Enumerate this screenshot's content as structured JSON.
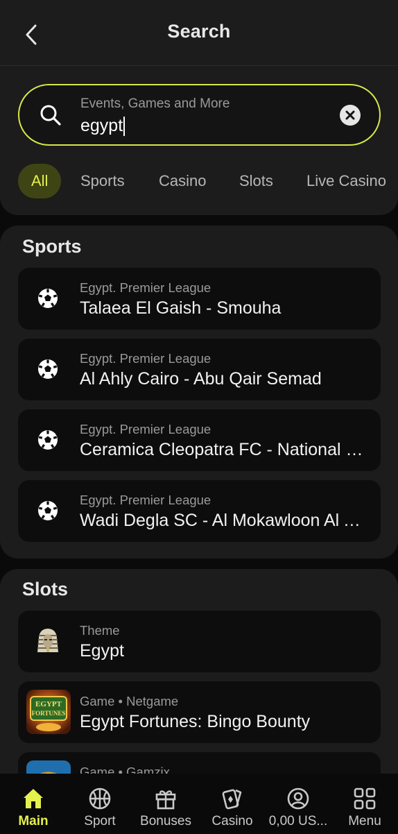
{
  "header": {
    "title": "Search"
  },
  "search": {
    "placeholder": "Events, Games and More",
    "value": "egypt"
  },
  "tabs": [
    {
      "label": "All",
      "active": true
    },
    {
      "label": "Sports"
    },
    {
      "label": "Casino"
    },
    {
      "label": "Slots"
    },
    {
      "label": "Live Casino"
    }
  ],
  "sports": {
    "title": "Sports",
    "items": [
      {
        "league": "Egypt. Premier League",
        "match": "Talaea El Gaish   - Smouha",
        "icon": "soccer-ball-icon"
      },
      {
        "league": "Egypt. Premier League",
        "match": "Al Ahly Cairo - Abu Qair Semad",
        "icon": "soccer-ball-icon"
      },
      {
        "league": "Egypt. Premier League",
        "match": "Ceramica Cleopatra FC - National Bank of Egypt",
        "icon": "soccer-ball-icon"
      },
      {
        "league": "Egypt. Premier League",
        "match": "Wadi Degla SC - Al Mokawloon Al Arab",
        "icon": "soccer-ball-icon"
      }
    ]
  },
  "slots": {
    "title": "Slots",
    "items": [
      {
        "subtitle": "Theme",
        "name": "Egypt",
        "icon": "pharaoh-icon"
      },
      {
        "subtitle": "Game • Netgame",
        "name": "Egypt Fortunes: Bingo Bounty",
        "icon": "egypt-fortunes-thumbnail",
        "thumb_text": [
          "EGYPT",
          "FORTUNES"
        ]
      },
      {
        "subtitle": "Game • Gamzix",
        "name": "",
        "icon": "game-thumbnail"
      }
    ]
  },
  "bottom_nav": [
    {
      "label": "Main",
      "icon": "home-icon",
      "active": true
    },
    {
      "label": "Sport",
      "icon": "basketball-icon"
    },
    {
      "label": "Bonuses",
      "icon": "gift-icon"
    },
    {
      "label": "Casino",
      "icon": "cards-icon"
    },
    {
      "label": "0,00 US...",
      "icon": "account-icon"
    },
    {
      "label": "Menu",
      "icon": "grid-icon"
    }
  ],
  "colors": {
    "accent": "#e4f04d",
    "accent_border": "#d8e84a",
    "panel": "#1c1c1c",
    "card": "#0d0d0d",
    "background": "#0a0a0a"
  }
}
